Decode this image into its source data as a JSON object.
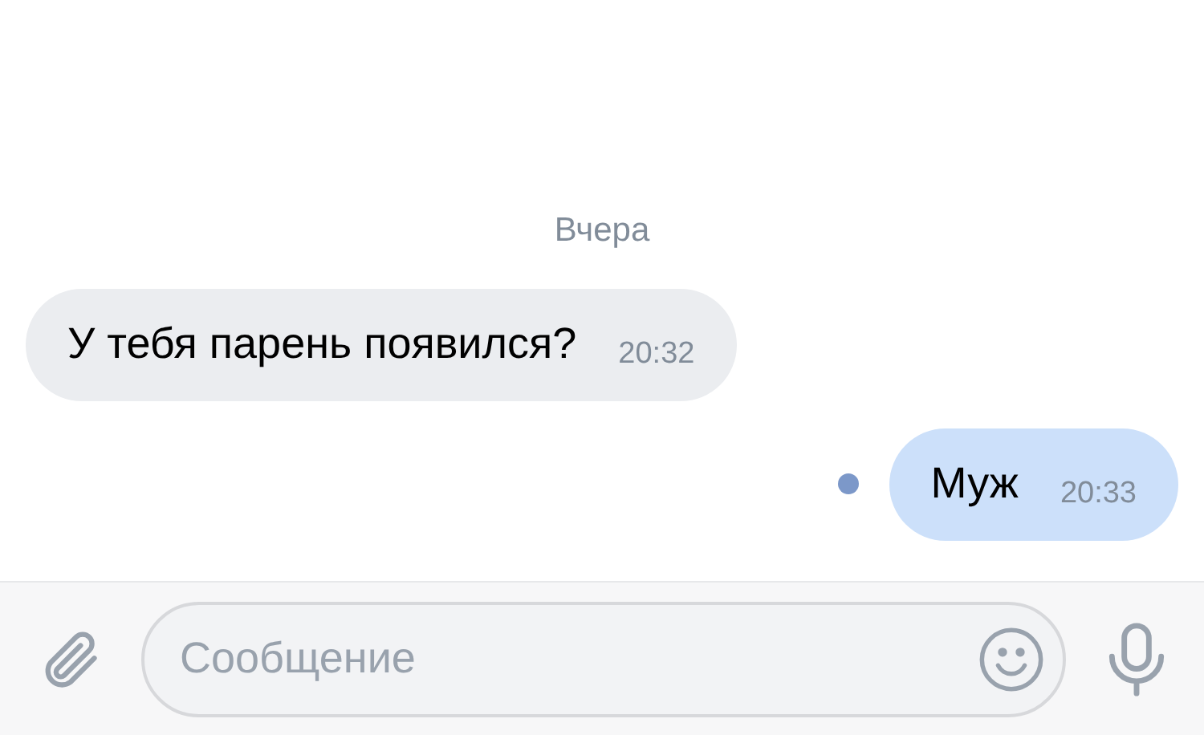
{
  "date_separator": "Вчера",
  "messages": [
    {
      "kind": "incoming",
      "text": "У тебя парень появился?",
      "time": "20:32",
      "unread": false
    },
    {
      "kind": "outgoing",
      "text": "Муж",
      "time": "20:33",
      "unread": true
    }
  ],
  "composer": {
    "placeholder": "Сообщение"
  }
}
